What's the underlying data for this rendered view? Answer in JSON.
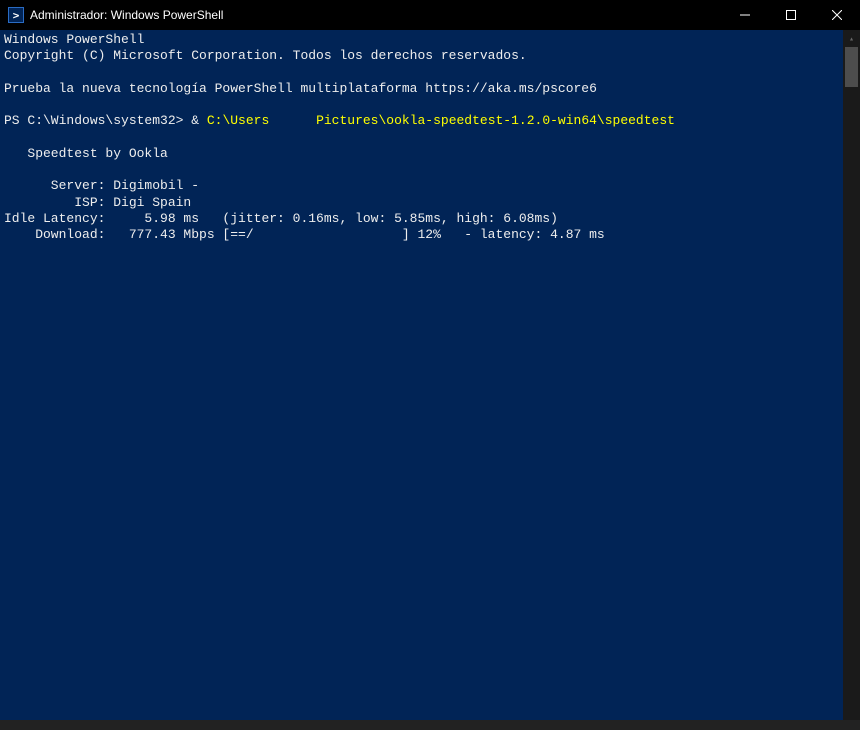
{
  "titlebar": {
    "title": "Administrador: Windows PowerShell"
  },
  "terminal": {
    "header_line1": "Windows PowerShell",
    "header_line2": "Copyright (C) Microsoft Corporation. Todos los derechos reservados.",
    "pscore_line": "Prueba la nueva tecnología PowerShell multiplataforma https://aka.ms/pscore6",
    "prompt_prefix": "PS C:\\Windows\\system32> & ",
    "prompt_path1": "C:\\Users",
    "prompt_path2": "Pictures\\ookla-speedtest-1.2.0-win64\\speedtest",
    "prompt_gap": "      ",
    "speedtest_title": "   Speedtest by Ookla",
    "server_line": "      Server: Digimobil -",
    "isp_line": "         ISP: Digi Spain",
    "latency_line": "Idle Latency:     5.98 ms   (jitter: 0.16ms, low: 5.85ms, high: 6.08ms)",
    "download_line": "    Download:   777.43 Mbps [==/                   ] 12%   - latency: 4.87 ms"
  }
}
